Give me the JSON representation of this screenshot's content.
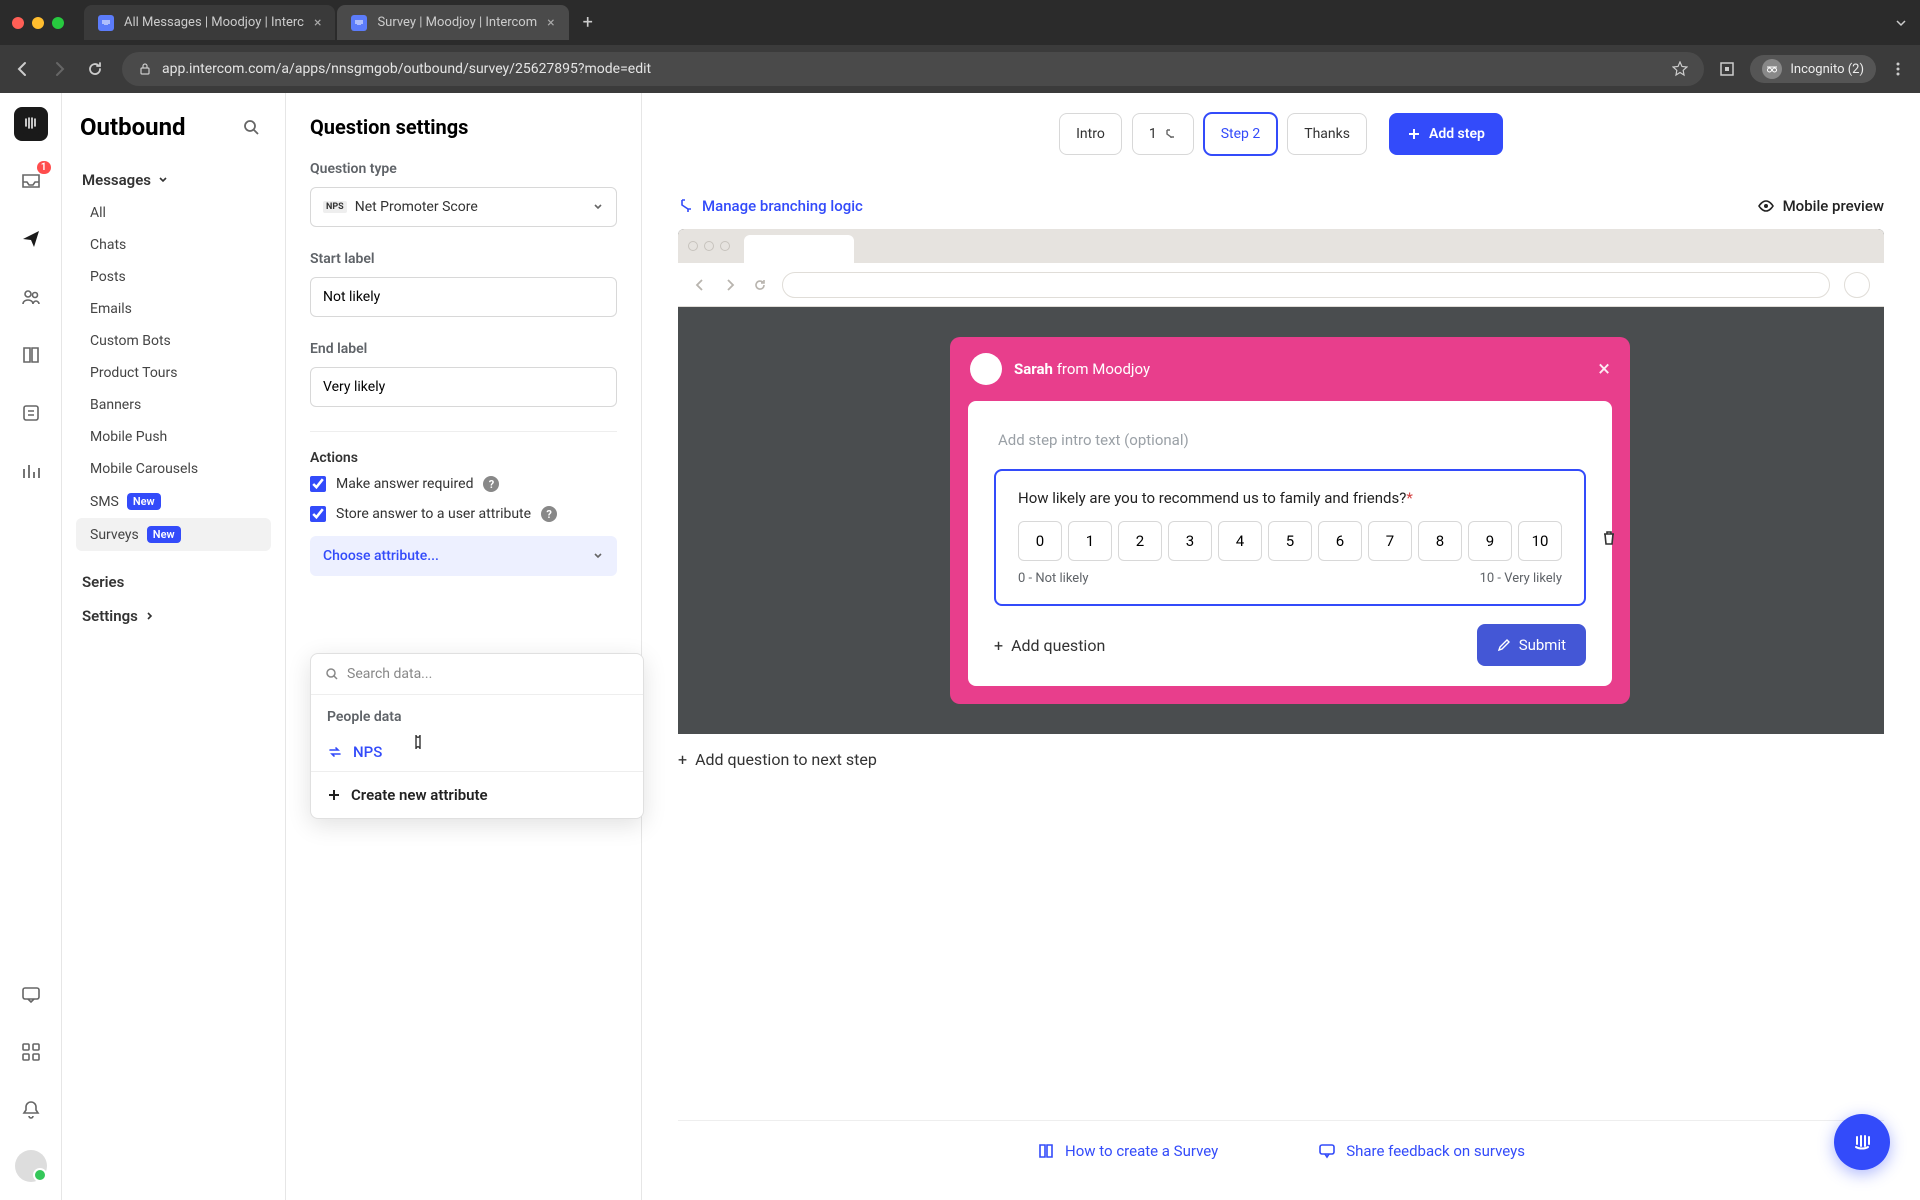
{
  "chrome": {
    "tabs": [
      {
        "title": "All Messages | Moodjoy | Interc"
      },
      {
        "title": "Survey | Moodjoy | Intercom"
      }
    ],
    "url": "app.intercom.com/a/apps/nnsgmgob/outbound/survey/25627895?mode=edit",
    "incognito_label": "Incognito (2)"
  },
  "rail": {
    "inbox_badge": "1"
  },
  "sidebar": {
    "title": "Outbound",
    "group": "Messages",
    "items": [
      "All",
      "Chats",
      "Posts",
      "Emails",
      "Custom Bots",
      "Product Tours",
      "Banners",
      "Mobile Push",
      "Mobile Carousels"
    ],
    "sms_label": "SMS",
    "sms_badge": "New",
    "surveys_label": "Surveys",
    "surveys_badge": "New",
    "series": "Series",
    "settings": "Settings"
  },
  "settings": {
    "title": "Question settings",
    "question_type_label": "Question type",
    "question_type_value": "Net Promoter Score",
    "nps_tag": "NPS",
    "start_label_label": "Start label",
    "start_label_value": "Not likely",
    "end_label_label": "End label",
    "end_label_value": "Very likely",
    "actions_label": "Actions",
    "make_required": "Make answer required",
    "store_attribute": "Store answer to a user attribute",
    "choose_attribute": "Choose attribute...",
    "dropdown": {
      "search_placeholder": "Search data...",
      "section": "People data",
      "option": "NPS",
      "create": "Create new attribute"
    }
  },
  "preview": {
    "steps": [
      "Intro",
      "1",
      "Step 2",
      "Thanks"
    ],
    "add_step": "Add step",
    "manage_branching": "Manage branching logic",
    "mobile_preview": "Mobile preview",
    "survey_from_name": "Sarah",
    "survey_from_suffix": "from Moodjoy",
    "intro_placeholder": "Add step intro text (optional)",
    "question": "How likely are you to recommend us to family and friends?",
    "nps_options": [
      "0",
      "1",
      "2",
      "3",
      "4",
      "5",
      "6",
      "7",
      "8",
      "9",
      "10"
    ],
    "low_label": "0 - Not likely",
    "high_label": "10 - Very likely",
    "add_question": "Add question",
    "submit": "Submit",
    "add_next_step": "Add question to next step"
  },
  "footer": {
    "how_to": "How to create a Survey",
    "share_feedback": "Share feedback on surveys"
  }
}
